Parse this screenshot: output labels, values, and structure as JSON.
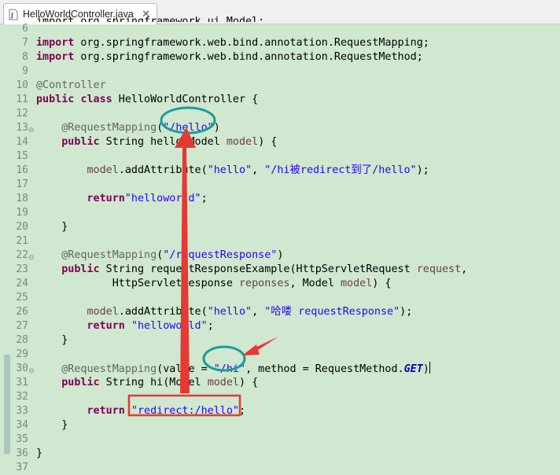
{
  "tab": {
    "title": "HelloWorldController.java",
    "close": "✕"
  },
  "lines": [
    {
      "n": "6",
      "fold": "",
      "segs": [
        {
          "t": "import org.springframework.ui.Model;",
          "c": "partial"
        }
      ]
    },
    {
      "n": "7",
      "fold": "",
      "segs": [
        {
          "t": "import",
          "c": "kw"
        },
        {
          "t": " org.springframework.web.bind.annotation.RequestMapping;",
          "c": ""
        }
      ]
    },
    {
      "n": "8",
      "fold": "",
      "segs": [
        {
          "t": "import",
          "c": "kw"
        },
        {
          "t": " org.springframework.web.bind.annotation.RequestMethod;",
          "c": ""
        }
      ]
    },
    {
      "n": "9",
      "fold": "",
      "segs": []
    },
    {
      "n": "10",
      "fold": "",
      "segs": [
        {
          "t": "@Controller",
          "c": "an"
        }
      ]
    },
    {
      "n": "11",
      "fold": "",
      "segs": [
        {
          "t": "public",
          "c": "kw"
        },
        {
          "t": " ",
          "c": ""
        },
        {
          "t": "class",
          "c": "kw"
        },
        {
          "t": " HelloWorldController {",
          "c": ""
        }
      ]
    },
    {
      "n": "12",
      "fold": "",
      "segs": []
    },
    {
      "n": "13",
      "fold": "⊖",
      "segs": [
        {
          "t": "    ",
          "c": ""
        },
        {
          "t": "@RequestMapping",
          "c": "an"
        },
        {
          "t": "(",
          "c": ""
        },
        {
          "t": "\"/hello\"",
          "c": "str"
        },
        {
          "t": ")",
          "c": ""
        }
      ]
    },
    {
      "n": "14",
      "fold": "",
      "segs": [
        {
          "t": "    ",
          "c": ""
        },
        {
          "t": "public",
          "c": "kw"
        },
        {
          "t": " String hello(Model ",
          "c": ""
        },
        {
          "t": "model",
          "c": "var"
        },
        {
          "t": ") {",
          "c": ""
        }
      ]
    },
    {
      "n": "15",
      "fold": "",
      "segs": []
    },
    {
      "n": "16",
      "fold": "",
      "segs": [
        {
          "t": "        ",
          "c": ""
        },
        {
          "t": "model",
          "c": "var"
        },
        {
          "t": ".addAttribute(",
          "c": ""
        },
        {
          "t": "\"hello\"",
          "c": "str"
        },
        {
          "t": ", ",
          "c": ""
        },
        {
          "t": "\"/hi被redirect到了/hello\"",
          "c": "str"
        },
        {
          "t": ");",
          "c": ""
        }
      ]
    },
    {
      "n": "17",
      "fold": "",
      "segs": []
    },
    {
      "n": "18",
      "fold": "",
      "segs": [
        {
          "t": "        ",
          "c": ""
        },
        {
          "t": "return",
          "c": "kw"
        },
        {
          "t": "\"helloworld\"",
          "c": "str"
        },
        {
          "t": ";",
          "c": ""
        }
      ]
    },
    {
      "n": "19",
      "fold": "",
      "segs": []
    },
    {
      "n": "20",
      "fold": "",
      "segs": [
        {
          "t": "    }",
          "c": ""
        }
      ]
    },
    {
      "n": "21",
      "fold": "",
      "segs": []
    },
    {
      "n": "22",
      "fold": "⊖",
      "segs": [
        {
          "t": "    ",
          "c": ""
        },
        {
          "t": "@RequestMapping",
          "c": "an"
        },
        {
          "t": "(",
          "c": ""
        },
        {
          "t": "\"/requestResponse\"",
          "c": "str"
        },
        {
          "t": ")",
          "c": ""
        }
      ]
    },
    {
      "n": "23",
      "fold": "",
      "segs": [
        {
          "t": "    ",
          "c": ""
        },
        {
          "t": "public",
          "c": "kw"
        },
        {
          "t": " String requestResponseExample(HttpServletRequest ",
          "c": ""
        },
        {
          "t": "request",
          "c": "var"
        },
        {
          "t": ",",
          "c": ""
        }
      ]
    },
    {
      "n": "24",
      "fold": "",
      "segs": [
        {
          "t": "            HttpServletResponse ",
          "c": ""
        },
        {
          "t": "reponses",
          "c": "var"
        },
        {
          "t": ", Model ",
          "c": ""
        },
        {
          "t": "model",
          "c": "var"
        },
        {
          "t": ") {",
          "c": ""
        }
      ]
    },
    {
      "n": "25",
      "fold": "",
      "segs": []
    },
    {
      "n": "26",
      "fold": "",
      "segs": [
        {
          "t": "        ",
          "c": ""
        },
        {
          "t": "model",
          "c": "var"
        },
        {
          "t": ".addAttribute(",
          "c": ""
        },
        {
          "t": "\"hello\"",
          "c": "str"
        },
        {
          "t": ", ",
          "c": ""
        },
        {
          "t": "\"哈喽 requestResponse\"",
          "c": "str"
        },
        {
          "t": ");",
          "c": ""
        }
      ]
    },
    {
      "n": "27",
      "fold": "",
      "segs": [
        {
          "t": "        ",
          "c": ""
        },
        {
          "t": "return",
          "c": "kw"
        },
        {
          "t": " ",
          "c": ""
        },
        {
          "t": "\"helloworld\"",
          "c": "str"
        },
        {
          "t": ";",
          "c": ""
        }
      ]
    },
    {
      "n": "28",
      "fold": "",
      "segs": [
        {
          "t": "    }",
          "c": ""
        }
      ]
    },
    {
      "n": "29",
      "fold": "",
      "segs": []
    },
    {
      "n": "30",
      "fold": "⊖",
      "segs": [
        {
          "t": "    ",
          "c": ""
        },
        {
          "t": "@RequestMapping",
          "c": "an"
        },
        {
          "t": "(value = ",
          "c": ""
        },
        {
          "t": "\"/hi\"",
          "c": "str"
        },
        {
          "t": ", method = RequestMethod.",
          "c": ""
        },
        {
          "t": "GET",
          "c": "const"
        },
        {
          "t": ")",
          "c": ""
        },
        {
          "t": "",
          "c": "cursor"
        }
      ]
    },
    {
      "n": "31",
      "fold": "",
      "segs": [
        {
          "t": "    ",
          "c": ""
        },
        {
          "t": "public",
          "c": "kw"
        },
        {
          "t": " String hi(Model ",
          "c": ""
        },
        {
          "t": "model",
          "c": "var"
        },
        {
          "t": ") {",
          "c": ""
        }
      ]
    },
    {
      "n": "32",
      "fold": "",
      "segs": []
    },
    {
      "n": "33",
      "fold": "",
      "segs": [
        {
          "t": "        ",
          "c": ""
        },
        {
          "t": "return",
          "c": "kw"
        },
        {
          "t": " ",
          "c": ""
        },
        {
          "t": "\"redirect:/hello\"",
          "c": "str"
        },
        {
          "t": ";",
          "c": ""
        }
      ]
    },
    {
      "n": "34",
      "fold": "",
      "segs": [
        {
          "t": "    }",
          "c": ""
        }
      ]
    },
    {
      "n": "35",
      "fold": "",
      "segs": []
    },
    {
      "n": "36",
      "fold": "",
      "segs": [
        {
          "t": "}",
          "c": ""
        }
      ]
    },
    {
      "n": "37",
      "fold": "",
      "segs": []
    }
  ],
  "annotations": {
    "ellipse_hello": "\"/hello\"",
    "ellipse_hi": "\"/hi\"",
    "box_redirect": "\"redirect:/hello\"",
    "color": "#e53935",
    "ellipse_color": "#1a9c9c"
  }
}
